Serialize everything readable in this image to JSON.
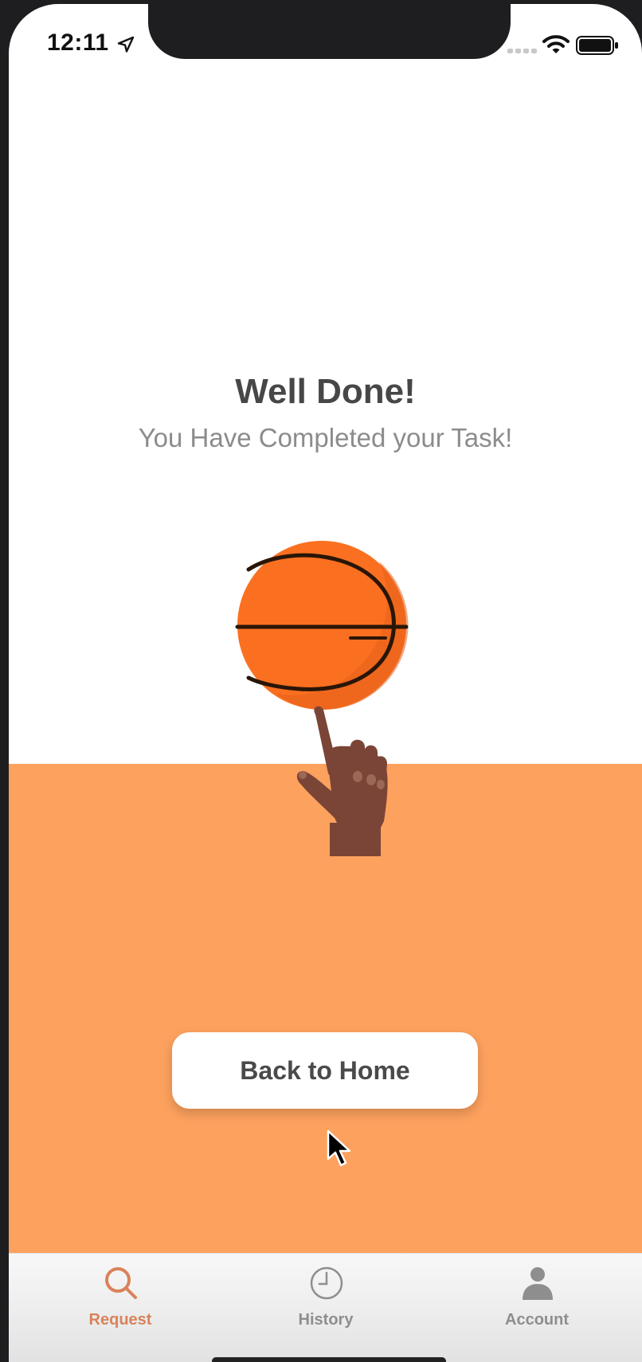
{
  "status_bar": {
    "time": "12:11",
    "icons": [
      "location-arrow-icon",
      "cellular-signal-icon",
      "wifi-icon",
      "battery-icon"
    ]
  },
  "completion": {
    "title": "Well Done!",
    "subtitle": "You Have Completed your Task!",
    "illustration": "hand-spinning-basketball"
  },
  "actions": {
    "back_home_label": "Back to Home"
  },
  "tab_bar": {
    "tabs": [
      {
        "label": "Request",
        "icon": "search-icon",
        "active": true
      },
      {
        "label": "History",
        "icon": "clock-icon",
        "active": false
      },
      {
        "label": "Account",
        "icon": "person-icon",
        "active": false
      }
    ]
  },
  "colors": {
    "accent": "#FDA15E",
    "ball": "#FB7020",
    "active_tab": "#D9825A",
    "inactive_tab": "#8E8E8E",
    "title_text": "#474747",
    "subtitle_text": "#8C8C8C"
  }
}
